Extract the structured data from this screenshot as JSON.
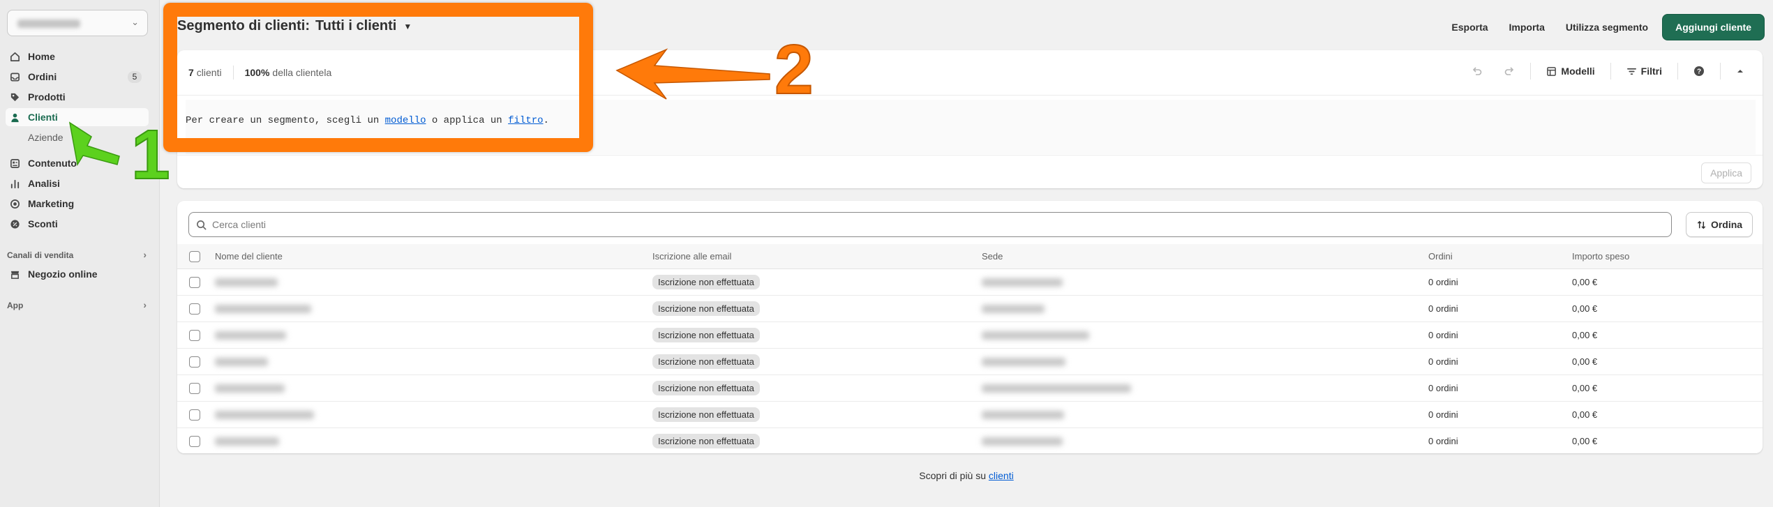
{
  "sidebar": {
    "nav": [
      {
        "label": "Home",
        "icon": "home-icon"
      },
      {
        "label": "Ordini",
        "icon": "orders-icon",
        "badge": "5"
      },
      {
        "label": "Prodotti",
        "icon": "tag-icon"
      },
      {
        "label": "Clienti",
        "icon": "person-icon",
        "active": true
      },
      {
        "label": "Aziende",
        "sub": true
      },
      {
        "label": "Contenuto",
        "icon": "content-icon"
      },
      {
        "label": "Analisi",
        "icon": "analytics-icon"
      },
      {
        "label": "Marketing",
        "icon": "target-icon"
      },
      {
        "label": "Sconti",
        "icon": "discount-icon"
      }
    ],
    "sales_channels_title": "Canali di vendita",
    "online_store": "Negozio online",
    "apps_title": "App"
  },
  "header": {
    "title_prefix": "Segmento di clienti:",
    "title_segment": "Tutti i clienti",
    "actions": {
      "export": "Esporta",
      "import": "Importa",
      "use_segment": "Utilizza segmento",
      "add_customer": "Aggiungi cliente"
    }
  },
  "segment": {
    "count_value": "7",
    "count_label": "clienti",
    "percent_value": "100%",
    "percent_label": "della clientela",
    "tools": {
      "templates": "Modelli",
      "filters": "Filtri"
    },
    "hint_before": "Per creare un segmento, scegli un",
    "hint_link_template": "modello",
    "hint_middle": "o applica un",
    "hint_link_filter": "filtro",
    "hint_after": ".",
    "apply": "Applica"
  },
  "table": {
    "search_placeholder": "Cerca clienti",
    "sort_label": "Ordina",
    "columns": [
      "Nome del cliente",
      "Iscrizione alle email",
      "Sede",
      "Ordini",
      "Importo speso"
    ],
    "rows": [
      {
        "email": "Iscrizione non effettuata",
        "orders": "0 ordini",
        "spent": "0,00 €"
      },
      {
        "email": "Iscrizione non effettuata",
        "orders": "0 ordini",
        "spent": "0,00 €"
      },
      {
        "email": "Iscrizione non effettuata",
        "orders": "0 ordini",
        "spent": "0,00 €"
      },
      {
        "email": "Iscrizione non effettuata",
        "orders": "0 ordini",
        "spent": "0,00 €"
      },
      {
        "email": "Iscrizione non effettuata",
        "orders": "0 ordini",
        "spent": "0,00 €"
      },
      {
        "email": "Iscrizione non effettuata",
        "orders": "0 ordini",
        "spent": "0,00 €"
      },
      {
        "email": "Iscrizione non effettuata",
        "orders": "0 ordini",
        "spent": "0,00 €"
      }
    ]
  },
  "footer": {
    "text": "Scopri di più su",
    "link": "clienti"
  },
  "annotations": {
    "label_1": "1",
    "label_2": "2",
    "green": "#5cd11e",
    "orange": "#ff7a0a"
  },
  "colors": {
    "primary": "#1f6e53",
    "active_nav": "#1a6b50",
    "link": "#005bd3"
  }
}
